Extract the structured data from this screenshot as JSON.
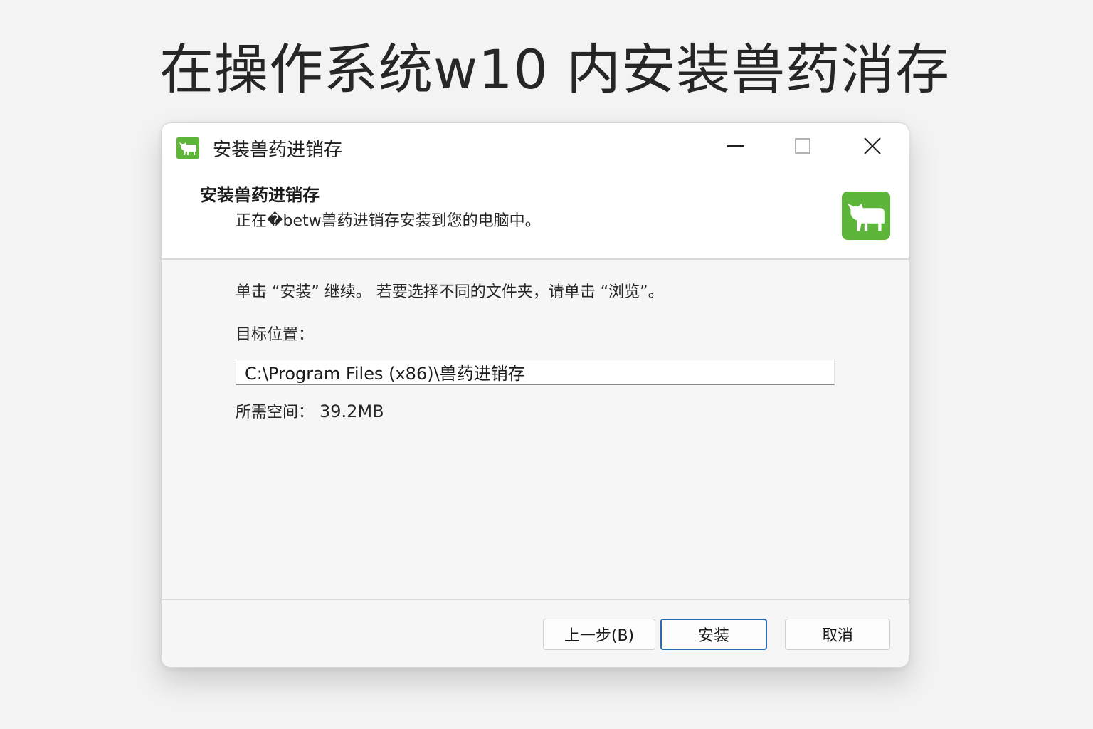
{
  "page": {
    "heading": "在操作系统w10 内安装兽药消存"
  },
  "window": {
    "title": "安装兽药进销存",
    "controls": {
      "minimize_icon": "minimize-icon",
      "maximize_icon": "maximize-icon",
      "close_icon": "close-icon"
    },
    "app_icon": "cow-icon",
    "accent_color": "#5db539"
  },
  "header": {
    "title": "安装兽药进销存",
    "subtitle": "正在�betw兽药进销存安装到您的电脑中。"
  },
  "body": {
    "instruction": "单击 “安装” 继续。  若要选择不同的文件夹，请单击 “浏览”。",
    "destination_label": "目标位置：",
    "destination_path": "C:\\Program Files (x86)\\兽药进销存",
    "space_label": "所需空间：",
    "space_value": "39.2MB"
  },
  "footer": {
    "back_label": "上一步(B)",
    "install_label": "安装",
    "cancel_label": "取消"
  }
}
